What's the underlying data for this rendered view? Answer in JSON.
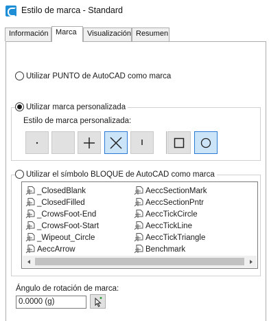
{
  "window": {
    "title": "Estilo de marca - Standard",
    "app_icon": "autocad-c-icon"
  },
  "tabs": [
    {
      "label": "Información",
      "active": false
    },
    {
      "label": "Marca",
      "active": true
    },
    {
      "label": "Visualización",
      "active": false
    },
    {
      "label": "Resumen",
      "active": false
    }
  ],
  "options": {
    "autocad_point": {
      "label": "Utilizar PUNTO de AutoCAD como marca",
      "checked": false
    },
    "custom_mark": {
      "label": "Utilizar marca personalizada",
      "checked": true
    },
    "block_symbol": {
      "label": "Utilizar el símbolo BLOQUE de AutoCAD como marca",
      "checked": false
    }
  },
  "custom_style": {
    "label": "Estilo de marca personalizada:",
    "buttons": [
      {
        "name": "dot",
        "icon": "dot-icon",
        "selected": false
      },
      {
        "name": "none",
        "icon": "blank-icon",
        "selected": false
      },
      {
        "name": "plus",
        "icon": "plus-icon",
        "selected": false
      },
      {
        "name": "x",
        "icon": "x-icon",
        "selected": true
      },
      {
        "name": "tick",
        "icon": "vertical-tick-icon",
        "selected": false
      },
      {
        "name": "square",
        "icon": "square-icon",
        "selected": false
      },
      {
        "name": "circle",
        "icon": "circle-icon",
        "selected": true
      }
    ]
  },
  "blocks": {
    "col1": [
      "_ClosedBlank",
      "_ClosedFilled",
      "_CrowsFoot-End",
      "_CrowsFoot-Start",
      "_Wipeout_Circle",
      "AeccArrow"
    ],
    "col2": [
      "AeccSectionMark",
      "AeccSectionPntr",
      "AeccTickCircle",
      "AeccTickLine",
      "AeccTickTriangle",
      "Benchmark"
    ]
  },
  "rotation": {
    "label": "Ángulo de rotación de marca:",
    "value": "0.0000 (g)"
  }
}
